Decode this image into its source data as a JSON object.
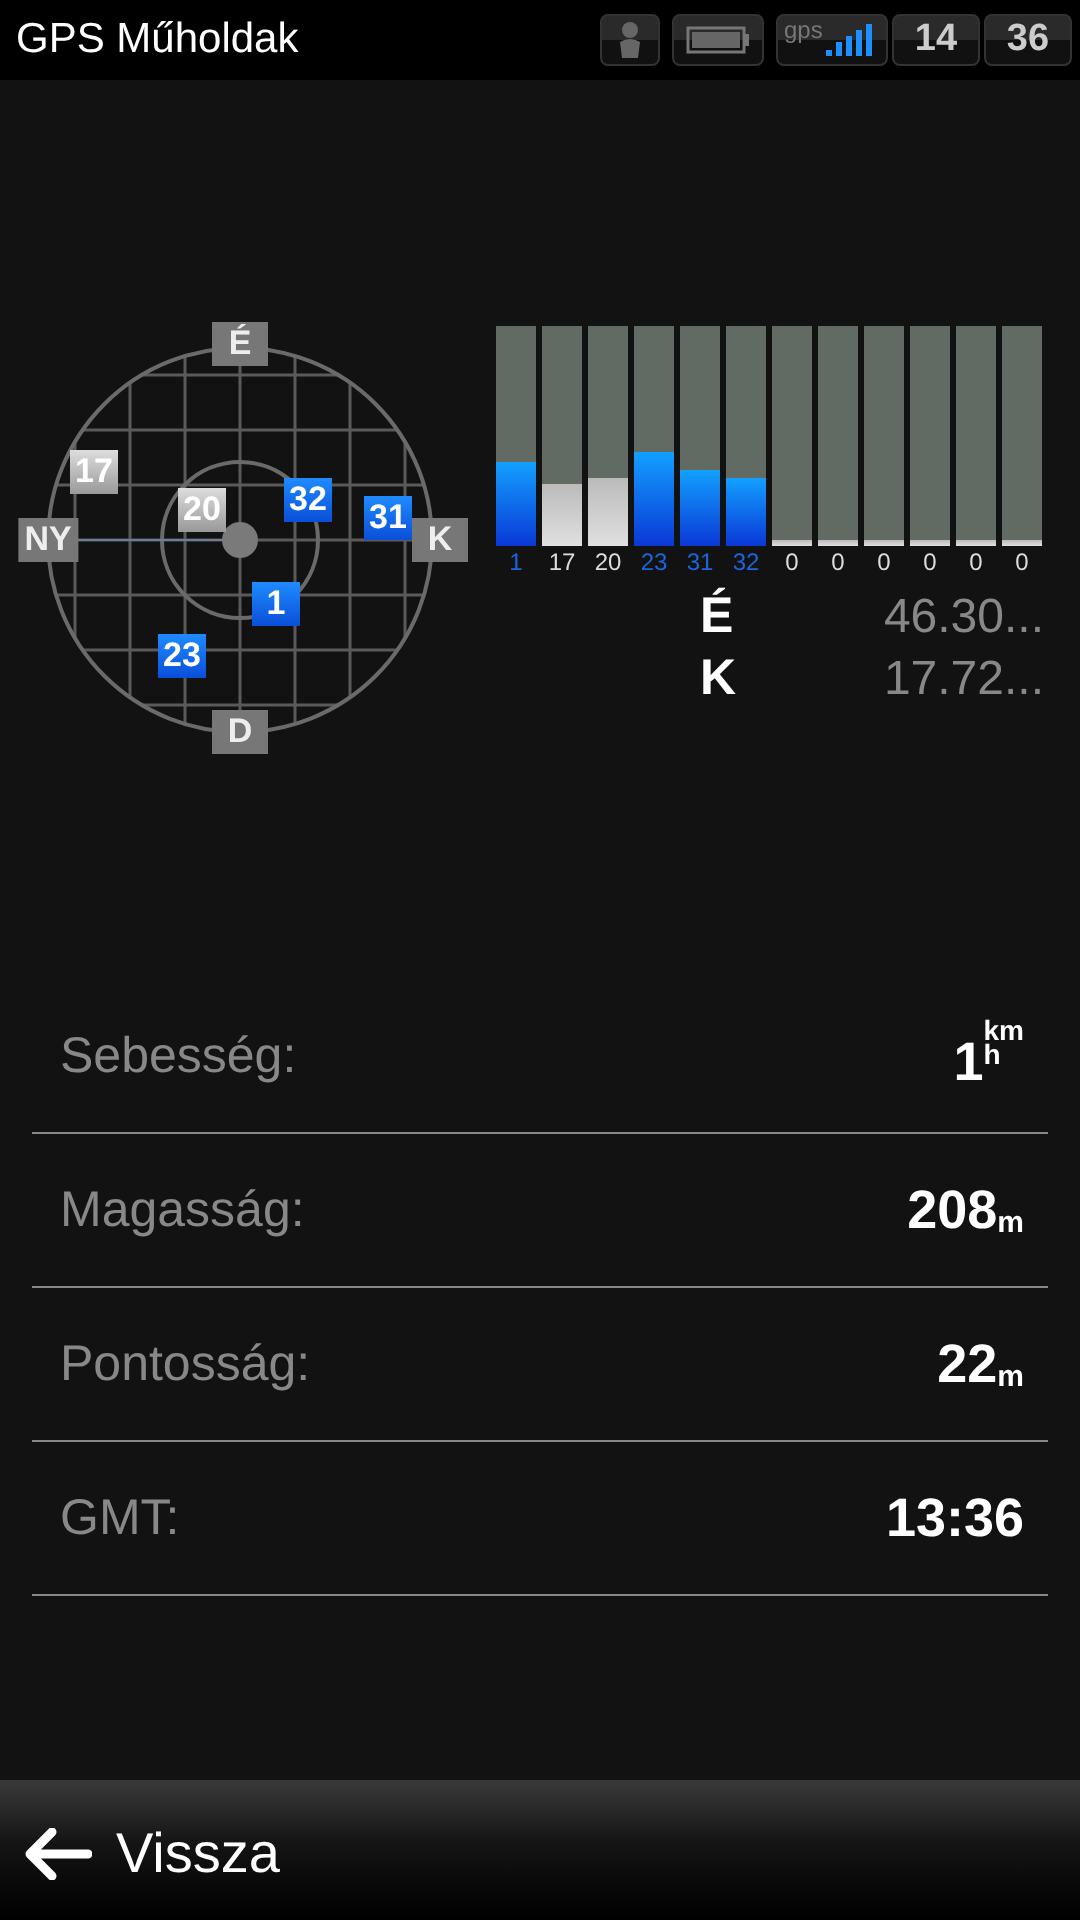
{
  "title_bar": {
    "title": "GPS Műholdak",
    "gps_label": "gps",
    "clock_hours": "14",
    "clock_minutes": "36"
  },
  "sky_plot": {
    "directions": [
      {
        "kind": "north",
        "label": "É"
      },
      {
        "kind": "west",
        "label": "NY"
      },
      {
        "kind": "east",
        "label": "K"
      },
      {
        "kind": "south",
        "label": "D"
      }
    ],
    "satellites": [
      {
        "number": "17",
        "used": false
      },
      {
        "number": "20",
        "used": false
      },
      {
        "number": "32",
        "used": true
      },
      {
        "number": "31",
        "used": true
      },
      {
        "number": "1",
        "used": true
      },
      {
        "number": "23",
        "used": true
      }
    ]
  },
  "signal_bars": [
    {
      "label": "1",
      "used": true,
      "level": 0.38
    },
    {
      "label": "17",
      "used": false,
      "level": 0.28
    },
    {
      "label": "20",
      "used": false,
      "level": 0.31
    },
    {
      "label": "23",
      "used": true,
      "level": 0.43
    },
    {
      "label": "31",
      "used": true,
      "level": 0.35
    },
    {
      "label": "32",
      "used": true,
      "level": 0.31
    },
    {
      "label": "0",
      "used": false,
      "level": 0
    },
    {
      "label": "0",
      "used": false,
      "level": 0
    },
    {
      "label": "0",
      "used": false,
      "level": 0
    },
    {
      "label": "0",
      "used": false,
      "level": 0
    },
    {
      "label": "0",
      "used": false,
      "level": 0
    },
    {
      "label": "0",
      "used": false,
      "level": 0
    }
  ],
  "coordinates": [
    {
      "label": "É",
      "value": "46.30..."
    },
    {
      "label": "K",
      "value": "17.72..."
    }
  ],
  "details": [
    {
      "label": "Sebesség:",
      "value": "1",
      "kind": "fraction",
      "unit_top": "km",
      "unit_bottom": "h"
    },
    {
      "label": "Magasság:",
      "value": "208",
      "kind": "unit",
      "unit": "m"
    },
    {
      "label": "Pontosság:",
      "value": "22",
      "kind": "unit",
      "unit": "m"
    },
    {
      "label": "GMT:",
      "value": "13:36",
      "kind": "plain"
    }
  ],
  "back_button": {
    "label": "Vissza"
  }
}
